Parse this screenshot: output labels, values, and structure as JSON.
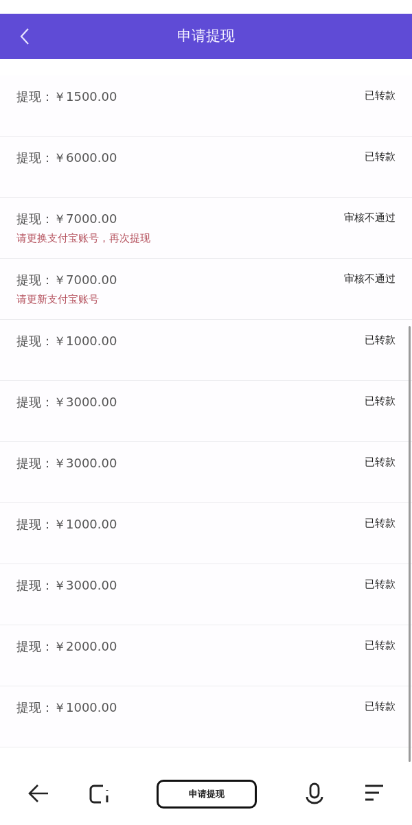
{
  "header": {
    "title": "申请提现"
  },
  "rows": [
    {
      "label": "提现：",
      "amount": "￥1500.00",
      "status": "已转款"
    },
    {
      "label": "提现：",
      "amount": "￥6000.00",
      "status": "已转款"
    },
    {
      "label": "提现：",
      "amount": "￥7000.00",
      "status": "审核不通过",
      "note": "请更换支付宝账号，再次提现"
    },
    {
      "label": "提现：",
      "amount": "￥7000.00",
      "status": "审核不通过",
      "note": "请更新支付宝账号"
    },
    {
      "label": "提现：",
      "amount": "￥1000.00",
      "status": "已转款"
    },
    {
      "label": "提现：",
      "amount": "￥3000.00",
      "status": "已转款"
    },
    {
      "label": "提现：",
      "amount": "￥3000.00",
      "status": "已转款"
    },
    {
      "label": "提现：",
      "amount": "￥1000.00",
      "status": "已转款"
    },
    {
      "label": "提现：",
      "amount": "￥3000.00",
      "status": "已转款"
    },
    {
      "label": "提现：",
      "amount": "￥2000.00",
      "status": "已转款"
    },
    {
      "label": "提现：",
      "amount": "￥1000.00",
      "status": "已转款"
    }
  ],
  "nav_bar": {
    "pill_label": "申请提现"
  }
}
